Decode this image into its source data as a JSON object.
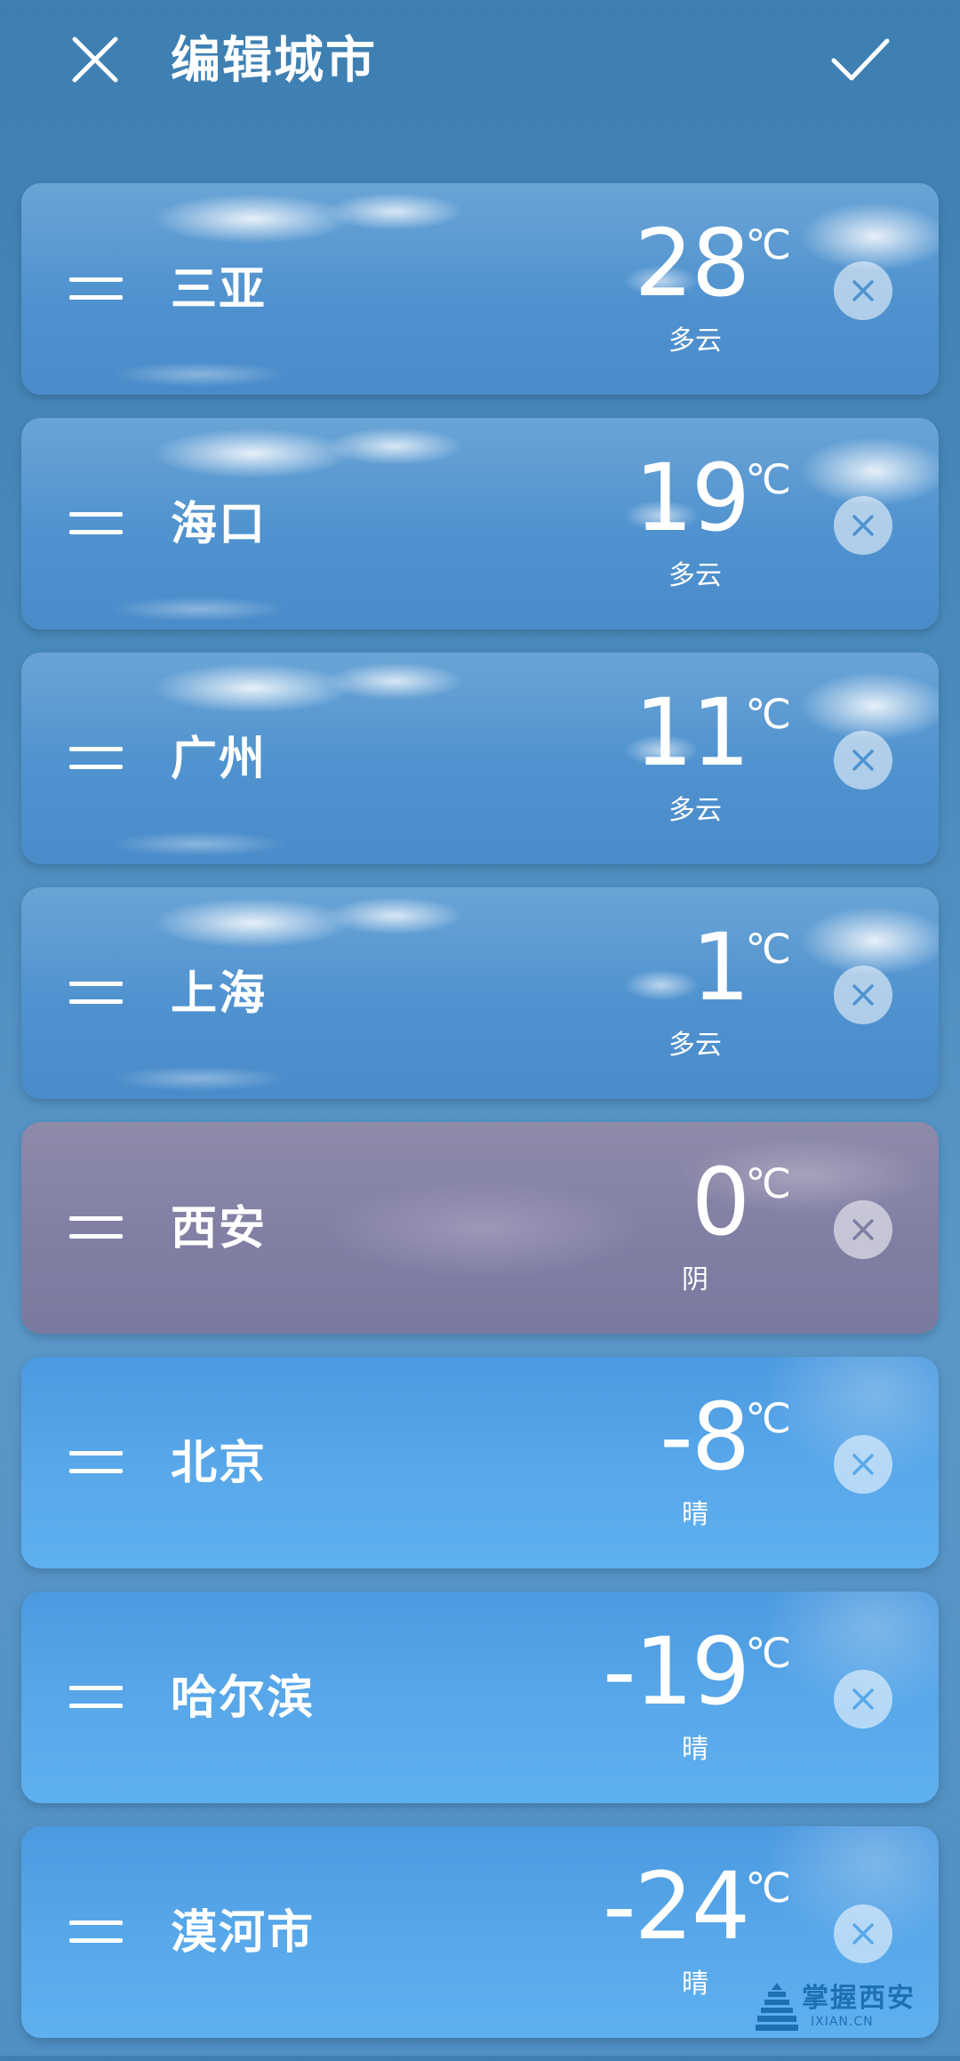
{
  "header": {
    "title": "编辑城市",
    "close_icon": "close-icon",
    "confirm_icon": "check-icon"
  },
  "cities": [
    {
      "name": "三亚",
      "temperature": "28",
      "unit": "℃",
      "condition": "多云",
      "background": "cloudy"
    },
    {
      "name": "海口",
      "temperature": "19",
      "unit": "℃",
      "condition": "多云",
      "background": "cloudy"
    },
    {
      "name": "广州",
      "temperature": "11",
      "unit": "℃",
      "condition": "多云",
      "background": "cloudy"
    },
    {
      "name": "上海",
      "temperature": "1",
      "unit": "℃",
      "condition": "多云",
      "background": "cloudy"
    },
    {
      "name": "西安",
      "temperature": "0",
      "unit": "℃",
      "condition": "阴",
      "background": "overcast"
    },
    {
      "name": "北京",
      "temperature": "-8",
      "unit": "℃",
      "condition": "晴",
      "background": "sunny"
    },
    {
      "name": "哈尔滨",
      "temperature": "-19",
      "unit": "℃",
      "condition": "晴",
      "background": "sunny"
    },
    {
      "name": "漠河市",
      "temperature": "-24",
      "unit": "℃",
      "condition": "晴",
      "background": "sunny"
    }
  ],
  "watermark": {
    "text": "掌握西安",
    "url": "IXIAN.CN"
  },
  "colors": {
    "page_background": "#4a8bbd",
    "cloudy_card": "#4f92cf",
    "overcast_card": "#7f7ea3",
    "sunny_card": "#58a8ea",
    "watermark_blue": "#1f6fb4"
  }
}
